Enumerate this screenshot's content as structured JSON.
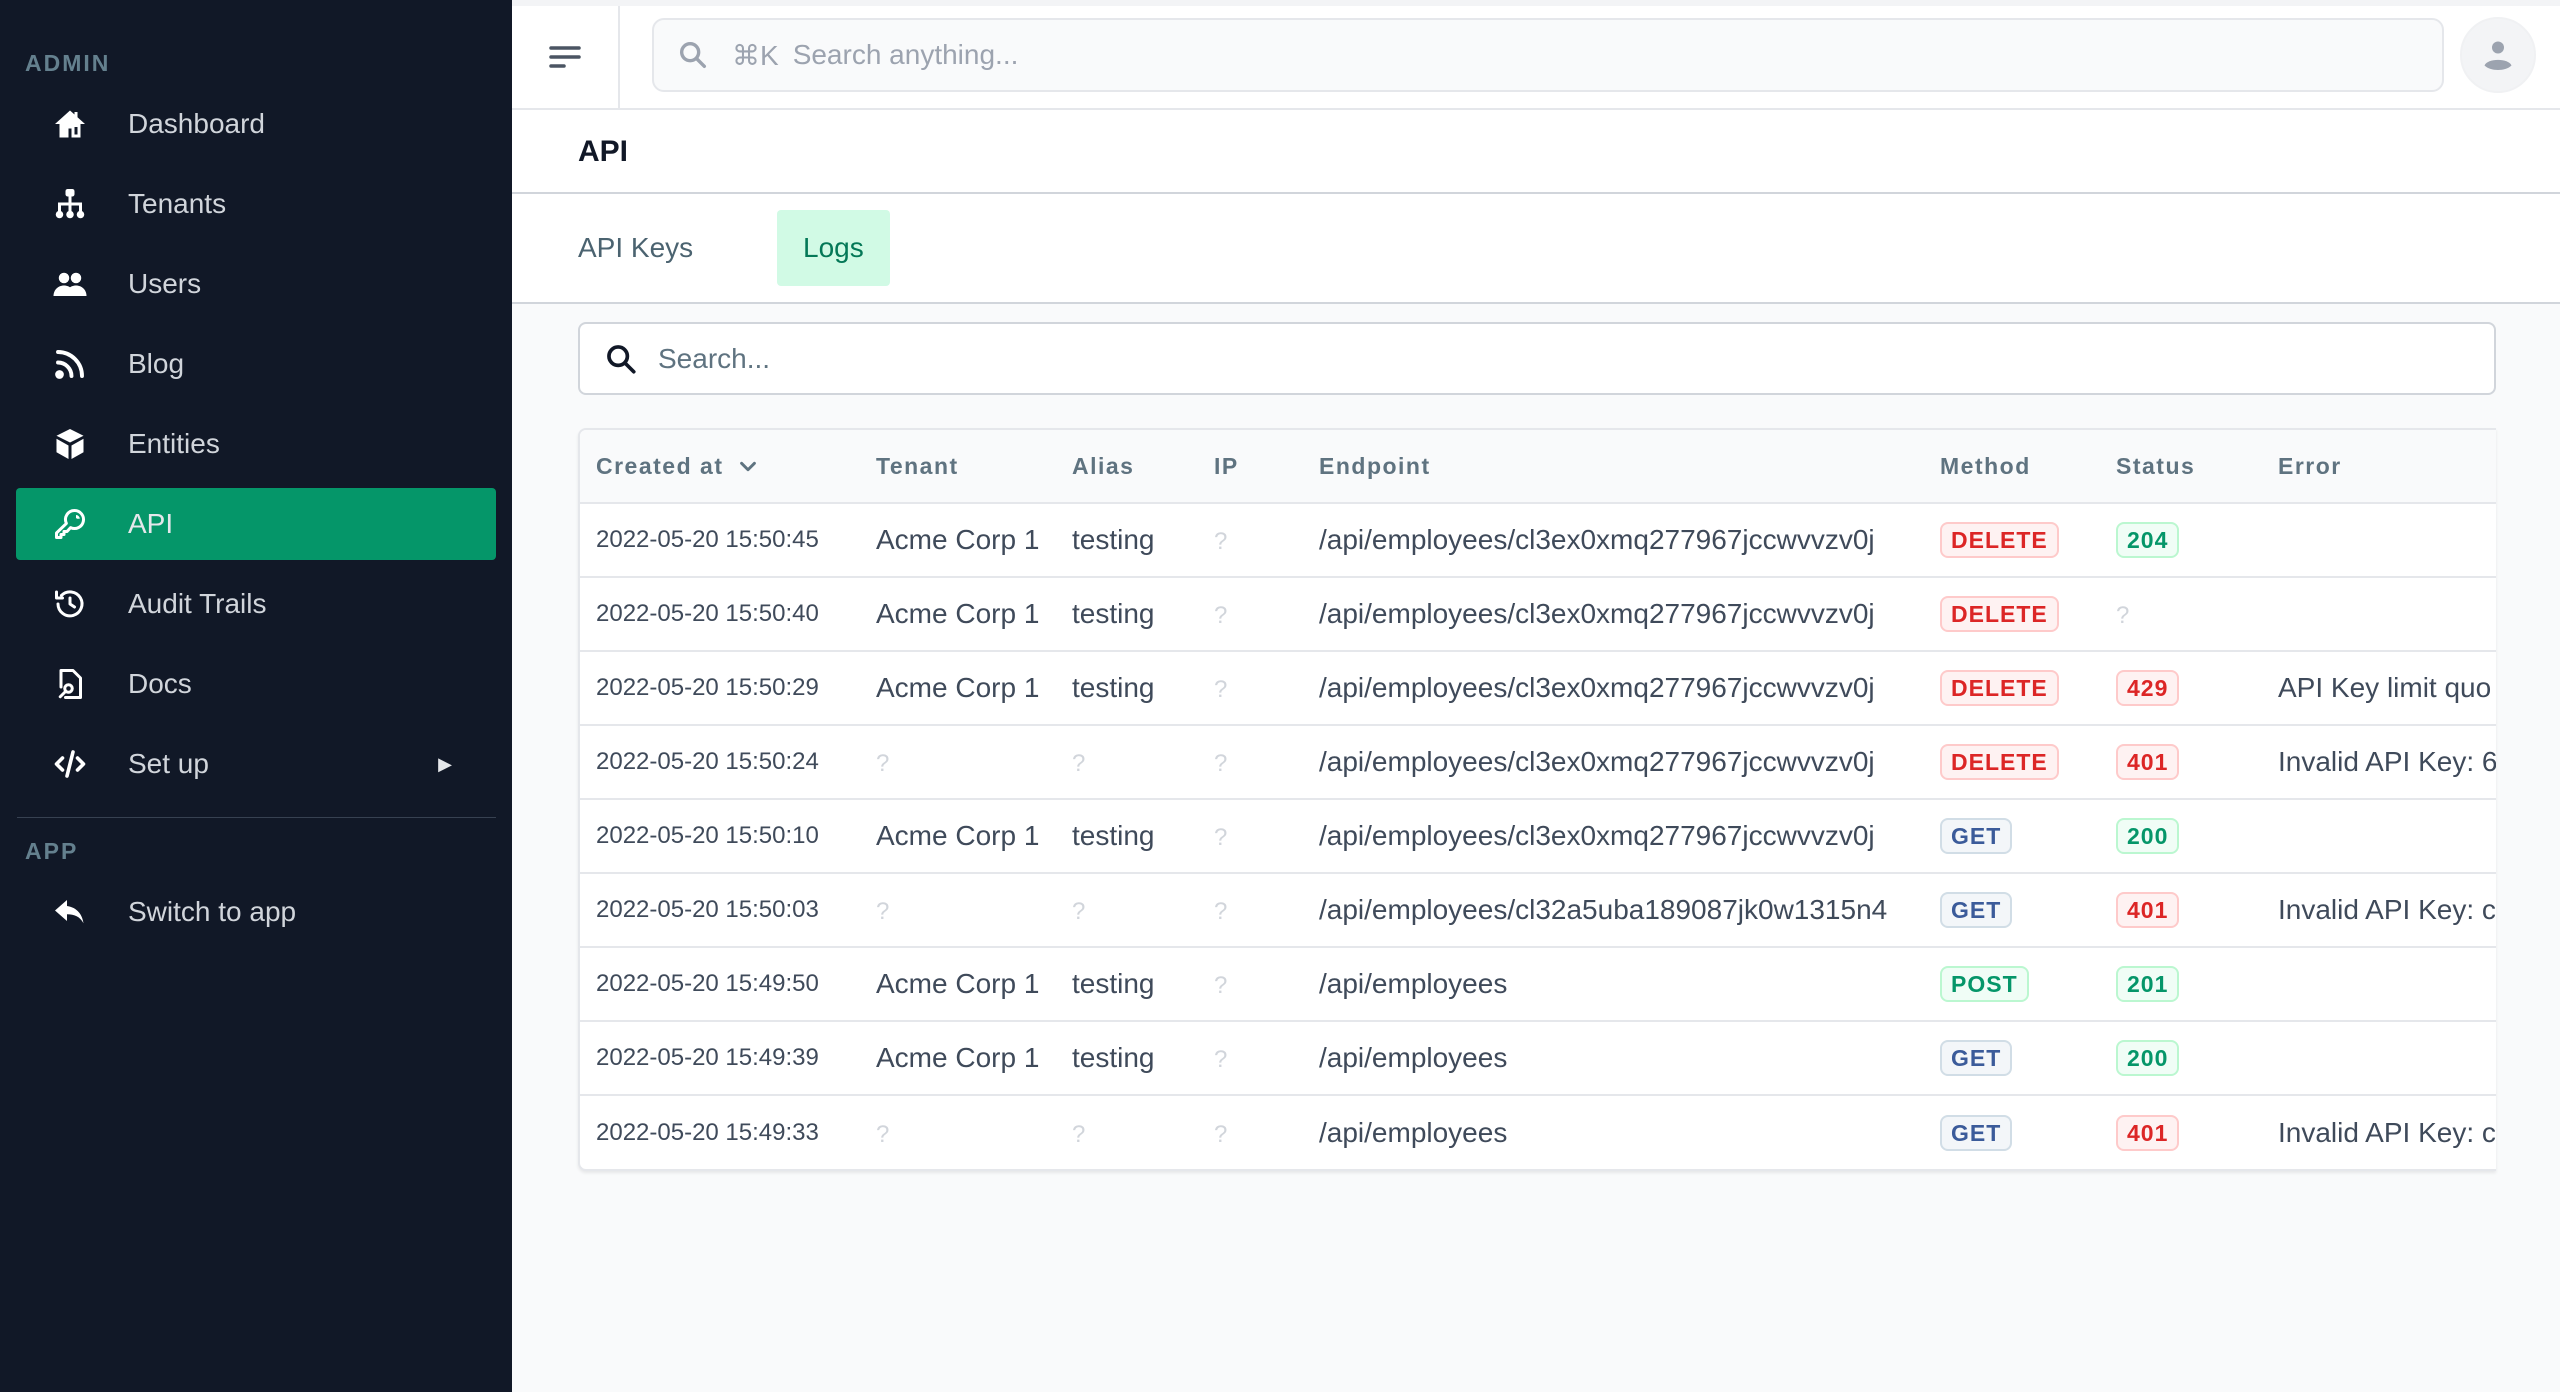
{
  "sidebar": {
    "sections": [
      {
        "label": "ADMIN"
      },
      {
        "label": "APP"
      }
    ],
    "items": [
      {
        "label": "Dashboard",
        "icon": "home-icon"
      },
      {
        "label": "Tenants",
        "icon": "sitemap-icon"
      },
      {
        "label": "Users",
        "icon": "users-icon"
      },
      {
        "label": "Blog",
        "icon": "rss-icon"
      },
      {
        "label": "Entities",
        "icon": "cube-icon"
      },
      {
        "label": "API",
        "icon": "key-icon",
        "active": true
      },
      {
        "label": "Audit Trails",
        "icon": "history-icon"
      },
      {
        "label": "Docs",
        "icon": "document-search-icon"
      },
      {
        "label": "Set up",
        "icon": "code-icon",
        "expandable": true,
        "arrow": "▶"
      },
      {
        "label": "Switch to app",
        "icon": "reply-icon"
      }
    ]
  },
  "header": {
    "search_shortcut": "⌘K",
    "search_placeholder": "Search anything..."
  },
  "page": {
    "title": "API",
    "tabs": [
      {
        "label": "API Keys",
        "active": false
      },
      {
        "label": "Logs",
        "active": true
      }
    ],
    "search_placeholder": "Search..."
  },
  "table": {
    "columns": [
      "Created at",
      "Tenant",
      "Alias",
      "IP",
      "Endpoint",
      "Method",
      "Status",
      "Error"
    ],
    "sort_column": "Created at",
    "rows": [
      {
        "created_at": "2022-05-20 15:50:45",
        "tenant": "Acme Corp 1",
        "alias": "testing",
        "ip": "?",
        "endpoint": "/api/employees/cl3ex0xmq277967jccwvvzv0j",
        "method": "DELETE",
        "status": "204",
        "error": ""
      },
      {
        "created_at": "2022-05-20 15:50:40",
        "tenant": "Acme Corp 1",
        "alias": "testing",
        "ip": "?",
        "endpoint": "/api/employees/cl3ex0xmq277967jccwvvzv0j",
        "method": "DELETE",
        "status": "?",
        "error": ""
      },
      {
        "created_at": "2022-05-20 15:50:29",
        "tenant": "Acme Corp 1",
        "alias": "testing",
        "ip": "?",
        "endpoint": "/api/employees/cl3ex0xmq277967jccwvvzv0j",
        "method": "DELETE",
        "status": "429",
        "error": "API Key limit quo"
      },
      {
        "created_at": "2022-05-20 15:50:24",
        "tenant": "?",
        "alias": "?",
        "ip": "?",
        "endpoint": "/api/employees/cl3ex0xmq277967jccwvvzv0j",
        "method": "DELETE",
        "status": "401",
        "error": "Invalid API Key: 6"
      },
      {
        "created_at": "2022-05-20 15:50:10",
        "tenant": "Acme Corp 1",
        "alias": "testing",
        "ip": "?",
        "endpoint": "/api/employees/cl3ex0xmq277967jccwvvzv0j",
        "method": "GET",
        "status": "200",
        "error": ""
      },
      {
        "created_at": "2022-05-20 15:50:03",
        "tenant": "?",
        "alias": "?",
        "ip": "?",
        "endpoint": "/api/employees/cl32a5uba189087jk0w1315n4",
        "method": "GET",
        "status": "401",
        "error": "Invalid API Key: c"
      },
      {
        "created_at": "2022-05-20 15:49:50",
        "tenant": "Acme Corp 1",
        "alias": "testing",
        "ip": "?",
        "endpoint": "/api/employees",
        "method": "POST",
        "status": "201",
        "error": ""
      },
      {
        "created_at": "2022-05-20 15:49:39",
        "tenant": "Acme Corp 1",
        "alias": "testing",
        "ip": "?",
        "endpoint": "/api/employees",
        "method": "GET",
        "status": "200",
        "error": ""
      },
      {
        "created_at": "2022-05-20 15:49:33",
        "tenant": "?",
        "alias": "?",
        "ip": "?",
        "endpoint": "/api/employees",
        "method": "GET",
        "status": "401",
        "error": "Invalid API Key: c"
      }
    ]
  },
  "colors": {
    "sidebar_bg": "#111827",
    "accent": "#059669",
    "active_tab_bg": "#d1fae5",
    "error_red": "#dc2626",
    "success_green": "#059669",
    "get_blue": "#3b5b9a"
  }
}
